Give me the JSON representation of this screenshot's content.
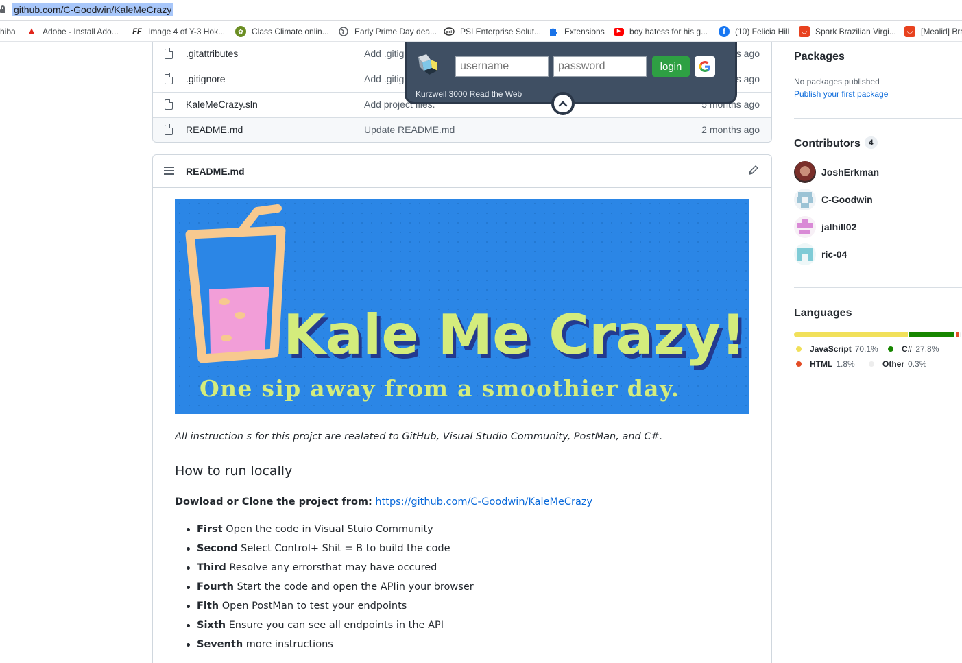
{
  "browser": {
    "url": "github.com/C-Goodwin/KaleMeCrazy"
  },
  "bookmarks": [
    {
      "label": "hiba",
      "icon": "none"
    },
    {
      "label": "Adobe - Install Ado...",
      "icon": "adobe-icon"
    },
    {
      "label": "Image 4 of Y-3 Hok...",
      "icon": "ff-icon"
    },
    {
      "label": "Class Climate onlin...",
      "icon": "class-climate-icon"
    },
    {
      "label": "Early Prime Day dea...",
      "icon": "globe-icon"
    },
    {
      "label": "PSI Enterprise Solut...",
      "icon": "psi-icon"
    },
    {
      "label": "Extensions",
      "icon": "puzzle-icon"
    },
    {
      "label": "boy hatess for his g...",
      "icon": "youtube-icon"
    },
    {
      "label": "(10) Felicia Hill",
      "icon": "facebook-icon"
    },
    {
      "label": "Spark Brazilian Virgi...",
      "icon": "shop-icon"
    },
    {
      "label": "[Mealid] Bra",
      "icon": "shop-icon"
    }
  ],
  "files": [
    {
      "name": ".gitattributes",
      "message": "Add .gitig",
      "age": "s ago"
    },
    {
      "name": ".gitignore",
      "message": "Add .gitig",
      "age": "s ago"
    },
    {
      "name": "KaleMeCrazy.sln",
      "message": "Add project files.",
      "age": "5 months ago"
    },
    {
      "name": "README.md",
      "message": "Update README.md",
      "age": "2 months ago"
    }
  ],
  "readme": {
    "filename": "README.md",
    "banner_title": "Kale Me Crazy!",
    "banner_tagline": "One sip away from a smoothier day.",
    "intro": "All instruction s for this projct are realated to GitHub, Visual Studio Community, PostMan, and C#.",
    "heading": "How to run locally",
    "download_label": "Dowload or Clone the project from:",
    "download_link": "https://github.com/C-Goodwin/KaleMeCrazy",
    "steps": [
      {
        "bold": "First",
        "text": " Open the code in Visual Stuio Community"
      },
      {
        "bold": "Second",
        "text": " Select Control+ Shit = B to build the code"
      },
      {
        "bold": "Third",
        "text": " Resolve any errorsthat may have occured"
      },
      {
        "bold": "Fourth",
        "text": " Start the code and open the APIin your browser"
      },
      {
        "bold": "Fith",
        "text": " Open PostMan to test your endpoints"
      },
      {
        "bold": "Sixth",
        "text": " Ensure you can see all endpoints in the API"
      },
      {
        "bold": "Seventh",
        "text": " more instructions"
      }
    ]
  },
  "popup": {
    "username_placeholder": "username",
    "password_placeholder": "password",
    "login_label": "login",
    "caption": "Kurzweil 3000 Read the Web"
  },
  "sidebar": {
    "packages_title": "Packages",
    "no_packages": "No packages published",
    "publish_link": "Publish your first package",
    "contributors_title": "Contributors",
    "contributors_count": "4",
    "contributors": [
      {
        "name": "JoshErkman"
      },
      {
        "name": "C-Goodwin"
      },
      {
        "name": "jalhill02"
      },
      {
        "name": "ric-04"
      }
    ],
    "languages_title": "Languages",
    "languages": [
      {
        "name": "JavaScript",
        "pct": "70.1%",
        "value": 70.1,
        "color": "#f1e05a"
      },
      {
        "name": "C#",
        "pct": "27.8%",
        "value": 27.8,
        "color": "#178600"
      },
      {
        "name": "HTML",
        "pct": "1.8%",
        "value": 1.8,
        "color": "#e34c26"
      },
      {
        "name": "Other",
        "pct": "0.3%",
        "value": 0.3,
        "color": "#ededed"
      }
    ]
  },
  "colors": {
    "link": "#0969da",
    "banner_bg": "#2b86e6",
    "banner_text": "#d4ec7c",
    "popup_bg": "#3f4f63",
    "login_green": "#2ea043"
  }
}
